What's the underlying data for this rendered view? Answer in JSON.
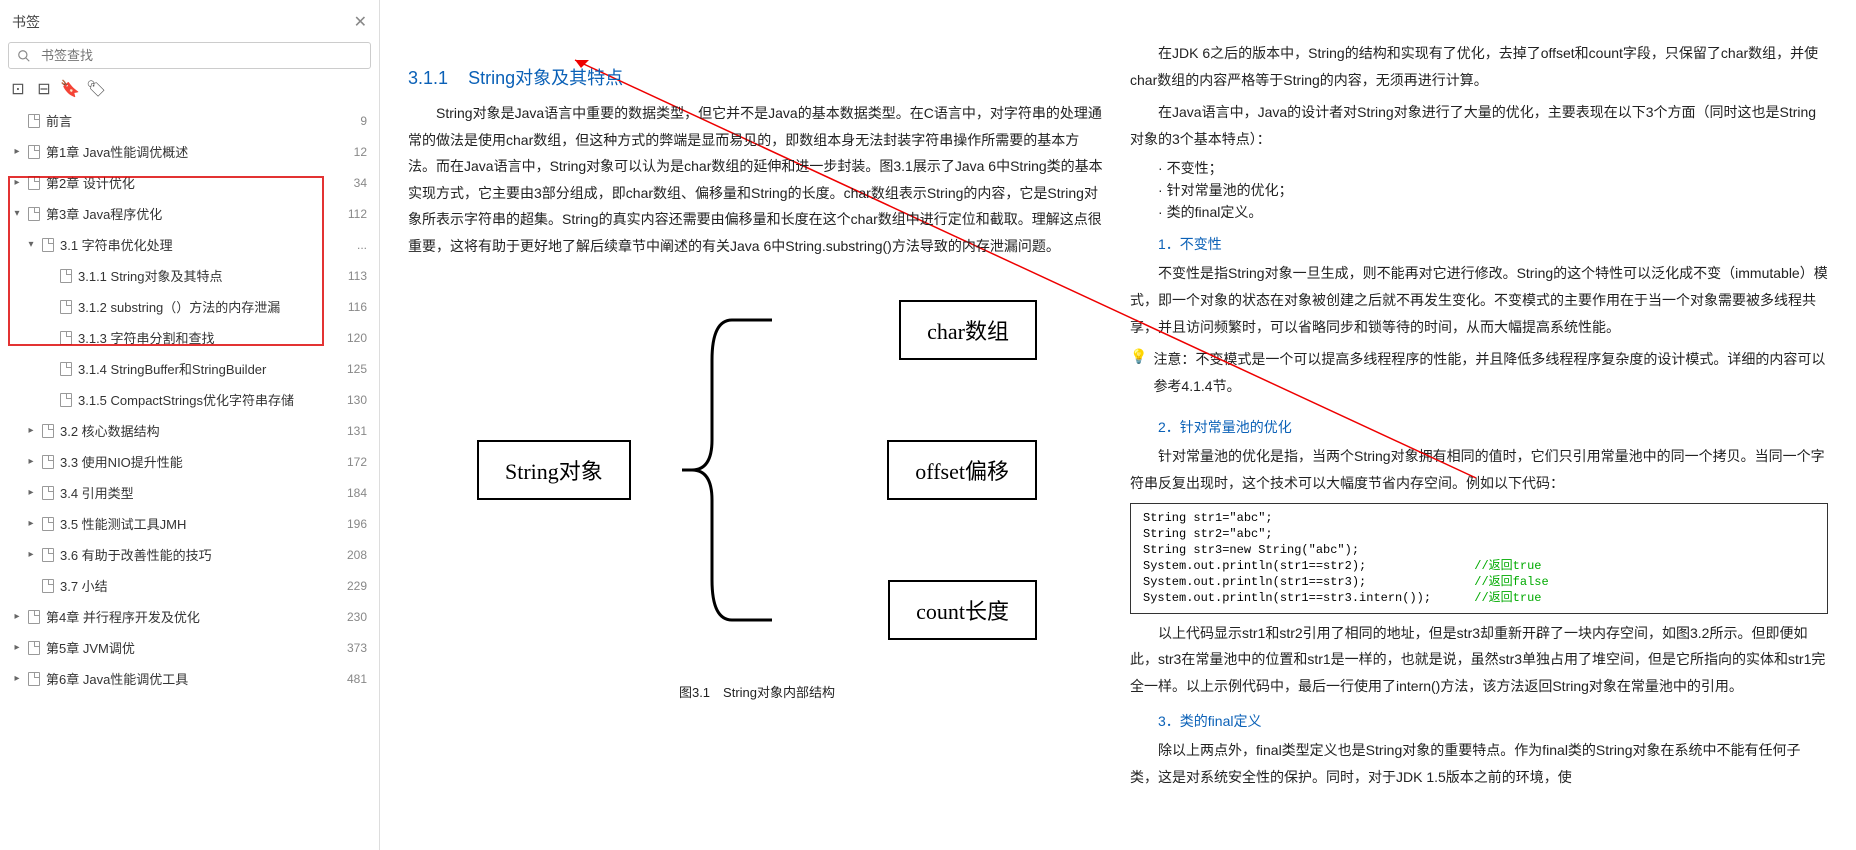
{
  "sidebar": {
    "title": "书签",
    "search_placeholder": "书签查找",
    "toc": [
      {
        "level": 0,
        "caret": "",
        "label": "前言",
        "page": "9"
      },
      {
        "level": 0,
        "caret": "▸",
        "label": "第1章  Java性能调优概述",
        "page": "12"
      },
      {
        "level": 0,
        "caret": "▸",
        "label": "第2章  设计优化",
        "page": "34"
      },
      {
        "level": 0,
        "caret": "▾",
        "label": "第3章  Java程序优化",
        "page": "112"
      },
      {
        "level": 1,
        "caret": "▾",
        "label": "3.1 字符串优化处理",
        "page": "..."
      },
      {
        "level": 2,
        "caret": "",
        "label": "3.1.1 String对象及其特点",
        "page": "113"
      },
      {
        "level": 2,
        "caret": "",
        "label": "3.1.2 substring（）方法的内存泄漏",
        "page": "116"
      },
      {
        "level": 2,
        "caret": "",
        "label": "3.1.3 字符串分割和查找",
        "page": "120"
      },
      {
        "level": 2,
        "caret": "",
        "label": "3.1.4 StringBuffer和StringBuilder",
        "page": "125"
      },
      {
        "level": 2,
        "caret": "",
        "label": "3.1.5 CompactStrings优化字符串存储",
        "page": "130"
      },
      {
        "level": 1,
        "caret": "▸",
        "label": "3.2 核心数据结构",
        "page": "131"
      },
      {
        "level": 1,
        "caret": "▸",
        "label": "3.3 使用NIO提升性能",
        "page": "172"
      },
      {
        "level": 1,
        "caret": "▸",
        "label": "3.4 引用类型",
        "page": "184"
      },
      {
        "level": 1,
        "caret": "▸",
        "label": "3.5 性能测试工具JMH",
        "page": "196"
      },
      {
        "level": 1,
        "caret": "▸",
        "label": "3.6 有助于改善性能的技巧",
        "page": "208"
      },
      {
        "level": 1,
        "caret": "",
        "label": "3.7 小结",
        "page": "229"
      },
      {
        "level": 0,
        "caret": "▸",
        "label": "第4章  并行程序开发及优化",
        "page": "230"
      },
      {
        "level": 0,
        "caret": "▸",
        "label": "第5章  JVM调优",
        "page": "373"
      },
      {
        "level": 0,
        "caret": "▸",
        "label": "第6章  Java性能调优工具",
        "page": "481"
      }
    ]
  },
  "page_left": {
    "section_no": "3.1.1",
    "section_title": "String对象及其特点",
    "para1": "String对象是Java语言中重要的数据类型，但它并不是Java的基本数据类型。在C语言中，对字符串的处理通常的做法是使用char数组，但这种方式的弊端是显而易见的，即数组本身无法封装字符串操作所需要的基本方法。而在Java语言中，String对象可以认为是char数组的延伸和进一步封装。图3.1展示了Java 6中String类的基本实现方式，它主要由3部分组成，即char数组、偏移量和String的长度。char数组表示String的内容，它是String对象所表示字符串的超集。String的真实内容还需要由偏移量和长度在这个char数组中进行定位和截取。理解这点很重要，这将有助于更好地了解后续章节中阐述的有关Java 6中String.substring()方法导致的内存泄漏问题。",
    "fig": {
      "boxA": "String对象",
      "boxB": "char数组",
      "boxC": "offset偏移",
      "boxD": "count长度",
      "caption": "图3.1　String对象内部结构"
    }
  },
  "page_right": {
    "para_top1": "在JDK 6之后的版本中，String的结构和实现有了优化，去掉了offset和count字段，只保留了char数组，并使char数组的内容严格等于String的内容，无须再进行计算。",
    "para_top2": "在Java语言中，Java的设计者对String对象进行了大量的优化，主要表现在以下3个方面（同时这也是String对象的3个基本特点）：",
    "bullets": [
      "不变性；",
      "针对常量池的优化；",
      "类的final定义。"
    ],
    "h1": "1．不变性",
    "p1a": "不变性是指String对象一旦生成，则不能再对它进行修改。String的这个特性可以泛化成不变（immutable）模式，即一个对象的状态在对象被创建之后就不再发生变化。不变模式的主要作用在于当一个对象需要被多线程共享，并且访问频繁时，可以省略同步和锁等待的时间，从而大幅提高系统性能。",
    "note_label": "注意：",
    "note_body": "不变模式是一个可以提高多线程程序的性能，并且降低多线程程序复杂度的设计模式。详细的内容可以参考4.1.4节。",
    "h2": "2．针对常量池的优化",
    "p2a": "针对常量池的优化是指，当两个String对象拥有相同的值时，它们只引用常量池中的同一个拷贝。当同一个字符串反复出现时，这个技术可以大幅度节省内存空间。例如以下代码：",
    "code": {
      "l1": "String str1=\"abc\";",
      "l2": "String str2=\"abc\";",
      "l3": "String str3=new String(\"abc\");",
      "l4a": "System.out.println(str1==str2);",
      "l4b": "//返回true",
      "l5a": "System.out.println(str1==str3);",
      "l5b": "//返回false",
      "l6a": "System.out.println(str1==str3.intern());",
      "l6b": "//返回true"
    },
    "p2b": "以上代码显示str1和str2引用了相同的地址，但是str3却重新开辟了一块内存空间，如图3.2所示。但即便如此，str3在常量池中的位置和str1是一样的，也就是说，虽然str3单独占用了堆空间，但是它所指向的实体和str1完全一样。以上示例代码中，最后一行使用了intern()方法，该方法返回String对象在常量池中的引用。",
    "h3": "3．类的final定义",
    "p3a": "除以上两点外，final类型定义也是String对象的重要特点。作为final类的String对象在系统中不能有任何子类，这是对系统安全性的保护。同时，对于JDK 1.5版本之前的环境，使"
  }
}
